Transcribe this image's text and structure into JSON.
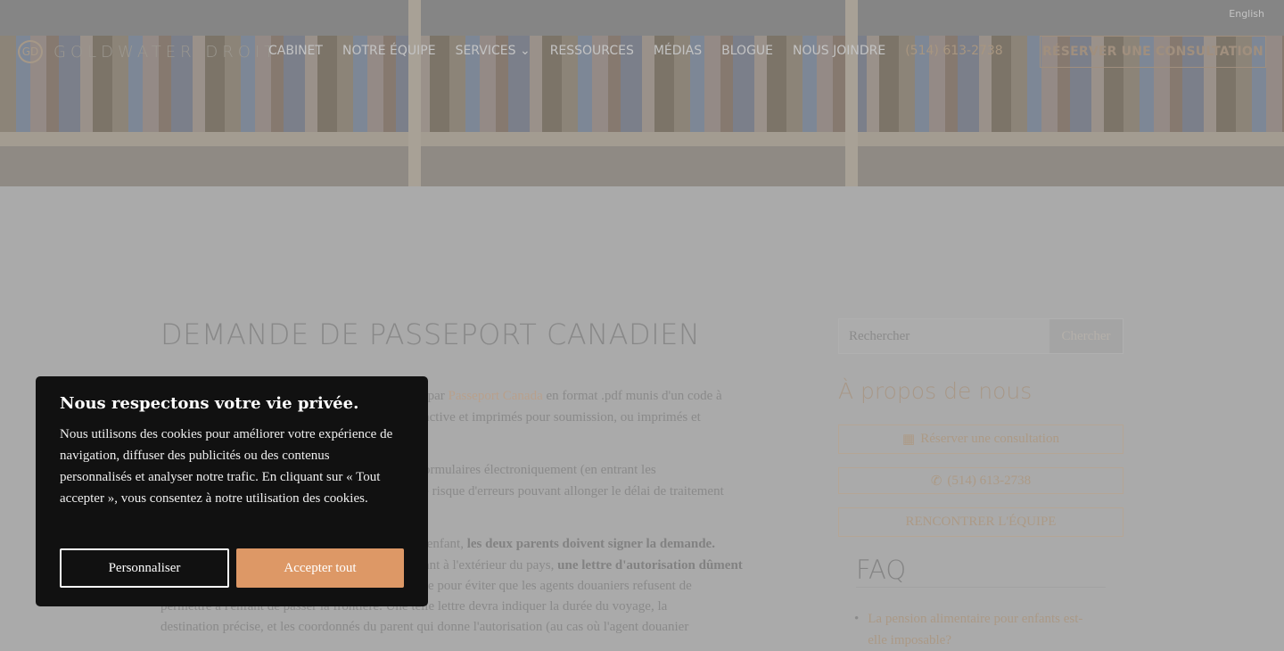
{
  "header": {
    "language_link": "English",
    "logo_mark": "GD",
    "logo_text": "GOLDWATER DROIT",
    "nav": [
      "CABINET",
      "NOTRE ÉQUIPE",
      "SERVICES",
      "RESSOURCES",
      "MÉDIAS",
      "BLOGUE",
      "NOUS JOINDRE"
    ],
    "phone": "(514) 613-2738",
    "cta": "RÉSERVER UNE CONSULTATION"
  },
  "article": {
    "title": "DEMANDE DE PASSEPORT CANADIEN",
    "lines": [
      {
        "pre": "s par ",
        "link": "Passeport Canada",
        "post": " en format .pdf munis d'un code à"
      },
      {
        "pre": "ractive et imprimés pour soumission, ou imprimés et"
      },
      {
        "pre": "formulaires électroniquement (en entrant les"
      },
      {
        "pre": "le risque d'erreurs pouvant allonger le délai de traitement"
      },
      {
        "pre": "r enfant, ",
        "bold": "les deux parents doivent signer la demande."
      },
      {
        "pre": "fant à l'extérieur du pays, ",
        "bold": "une lettre d'autorisation dûment"
      },
      {
        "pre": "ise pour éviter que les agents douaniers refusent de"
      },
      {
        "pre": "permettre à l'enfant de passer la frontière. Une telle lettre devra indiquer la durée du voyage, la"
      },
      {
        "pre": "destination précise, et les coordonnés du parent qui donne l'autorisation (au cas où l'agent douanier"
      }
    ]
  },
  "sidebar": {
    "search_placeholder": "Rechercher",
    "search_button": "Chercher",
    "about_title": "À propos de nous",
    "book_button": "Réserver une consultation",
    "phone_button": "(514) 613-2738",
    "team_button": "RENCONTRER L'ÉQUIPE",
    "faq_title": "FAQ",
    "faq_items": [
      "La pension alimentaire pour enfants est-elle imposable?"
    ]
  },
  "cookie": {
    "title": "Nous respectons votre vie privée.",
    "body": "Nous utilisons des cookies pour améliorer votre expérience de navigation, diffuser des publicités ou des contenus personnalisés et analyser notre trafic. En cliquant sur « Tout accepter », vous consentez à notre utilisation des cookies.",
    "customize": "Personnaliser",
    "accept": "Accepter tout"
  },
  "colors": {
    "accent": "#dd9866",
    "banner": "#111111",
    "link": "#b8a08c"
  }
}
